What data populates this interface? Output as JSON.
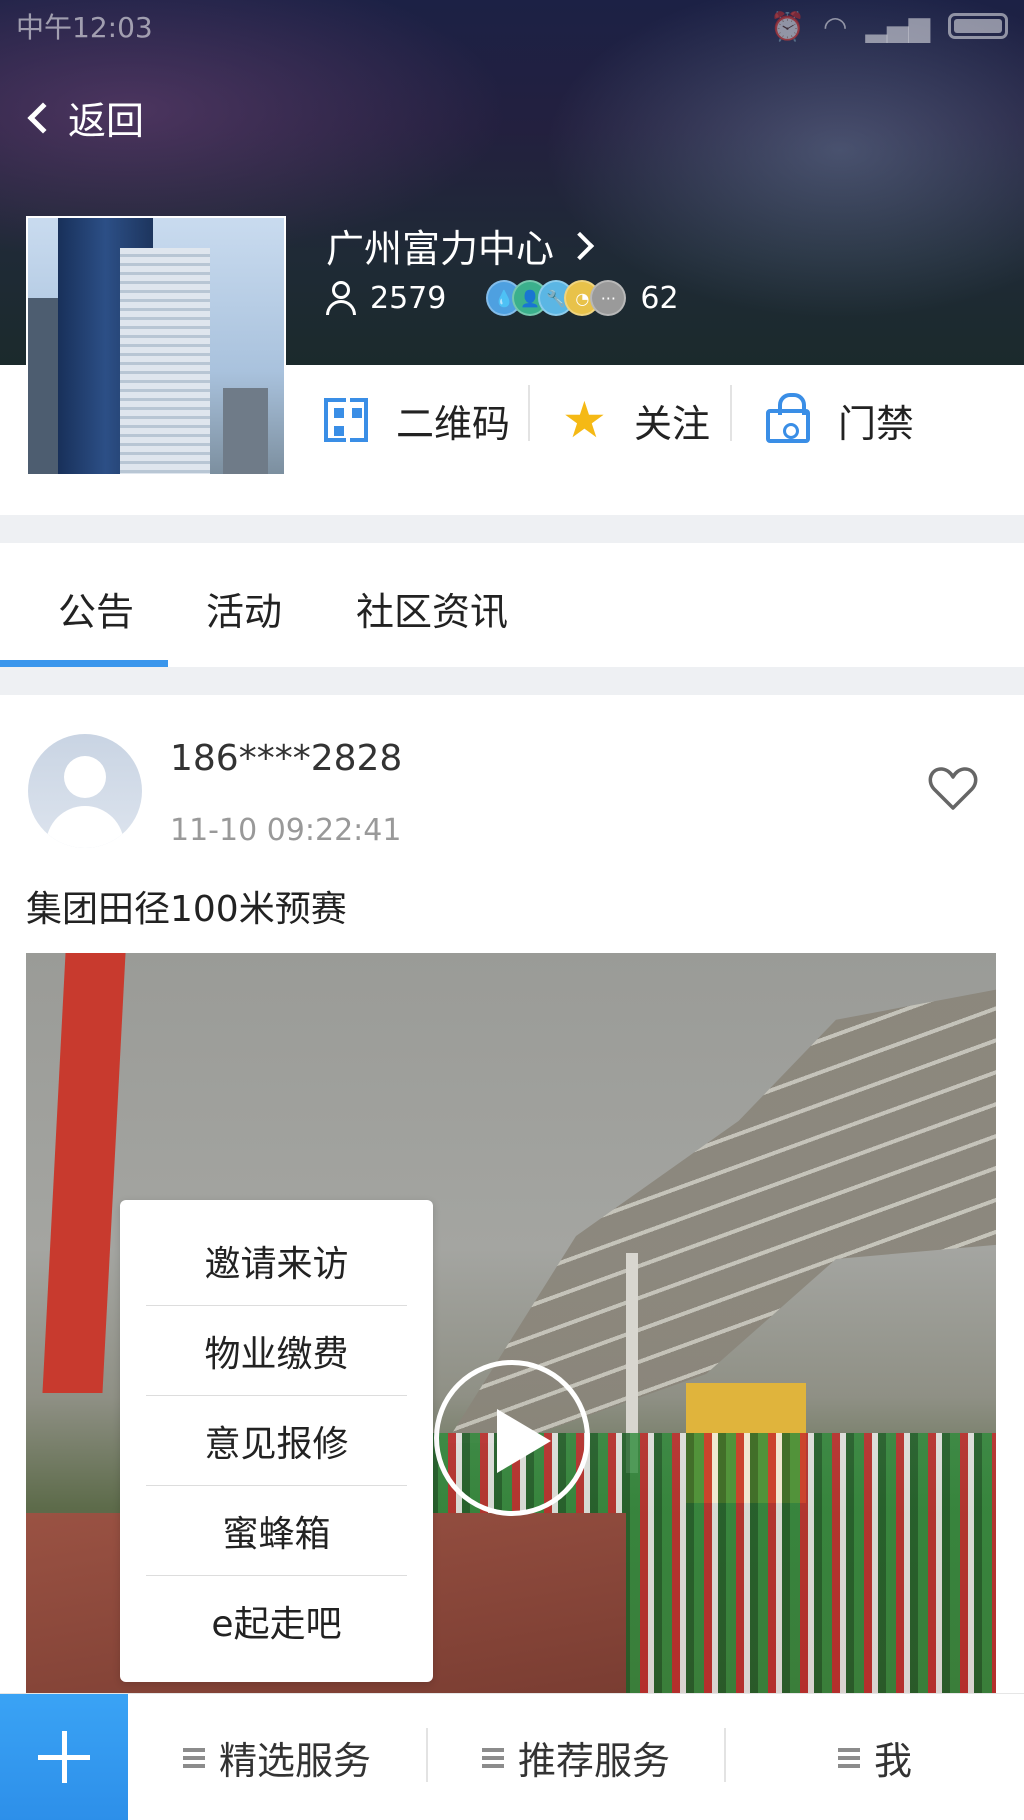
{
  "status_bar": {
    "time": "中午12:03"
  },
  "header": {
    "back_label": "返回",
    "community_name": "广州富力中心",
    "member_count": "2579",
    "badge_count": "62",
    "badge_more": "···"
  },
  "actions": {
    "qr_label": "二维码",
    "follow_label": "关注",
    "access_label": "门禁"
  },
  "tabs": [
    {
      "label": "公告"
    },
    {
      "label": "活动"
    },
    {
      "label": "社区资讯"
    }
  ],
  "post": {
    "user": "186****2828",
    "time": "11-10 09:22:41",
    "text": "集团田径100米预赛"
  },
  "popup_menu": [
    {
      "label": "邀请来访"
    },
    {
      "label": "物业缴费"
    },
    {
      "label": "意见报修"
    },
    {
      "label": "蜜蜂箱"
    },
    {
      "label": "e起走吧"
    }
  ],
  "bottom_nav": {
    "item1": "精选服务",
    "item2": "推荐服务",
    "item3": "我"
  },
  "colors": {
    "accent": "#3a96ec",
    "star": "#f5b915",
    "plus_button": "#2d8fe9"
  }
}
